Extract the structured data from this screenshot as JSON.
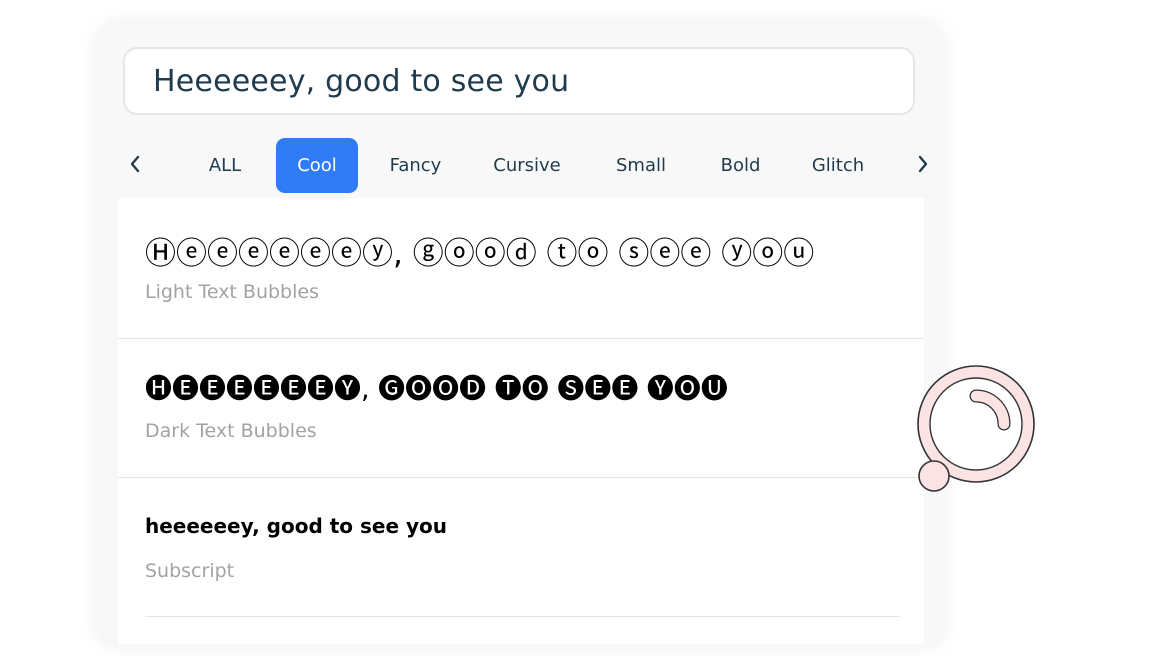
{
  "input": {
    "value": "Heeeeeey, good to see you"
  },
  "tabs": {
    "prev_label": "previous",
    "next_label": "next",
    "items": [
      {
        "label": "ALL"
      },
      {
        "label": "Cool",
        "active": true
      },
      {
        "label": "Fancy"
      },
      {
        "label": "Cursive"
      },
      {
        "label": "Small"
      },
      {
        "label": "Bold"
      },
      {
        "label": "Glitch"
      }
    ]
  },
  "results": [
    {
      "text": "Ⓗⓔⓔⓔⓔⓔⓔⓨ, ⓖⓞⓞⓓ ⓣⓞ ⓢⓔⓔ ⓨⓞⓤ",
      "label": "Light Text Bubbles"
    },
    {
      "text": "🅗🅔🅔🅔🅔🅔🅔🅨, 🅖🅞🅞🅓 🅣🅞 🅢🅔🅔 🅨🅞🅤",
      "label": "Dark Text Bubbles"
    },
    {
      "text": "heeeeeey, good to see you",
      "label": "Subscript"
    }
  ],
  "colors": {
    "accent": "#2f7cf6",
    "text": "#1f3b4d",
    "muted": "#a3a3a3"
  },
  "icons": {
    "prev": "chevron-left-icon",
    "next": "chevron-right-icon",
    "decoration": "ring-decoration"
  }
}
